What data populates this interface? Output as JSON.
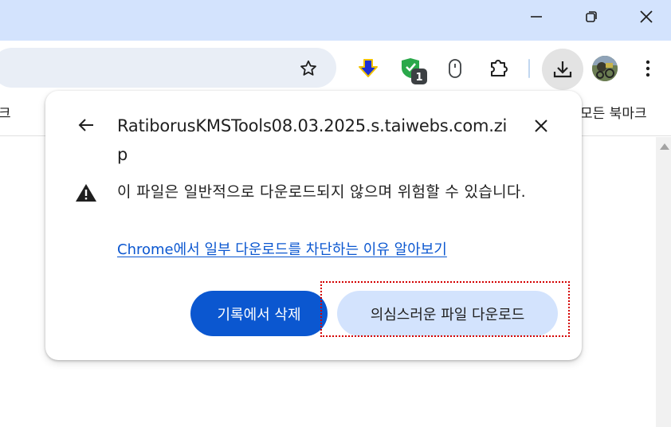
{
  "window": {
    "controls": [
      "minimize-icon",
      "restore-icon",
      "close-icon"
    ]
  },
  "toolbar": {
    "icons": [
      "bookmark-star-icon",
      "download-arrow-extension-icon",
      "shield-extension-icon",
      "mouse-extension-icon",
      "extensions-puzzle-icon",
      "downloads-icon",
      "profile-avatar",
      "more-menu-icon"
    ],
    "extension_badge": "1"
  },
  "bookmarks": {
    "left_fragment": "크",
    "all_bookmarks": "모든 북마크"
  },
  "popup": {
    "filename": "RatiborusKMSTools08.03.2025.s.taiwebs.com.zip",
    "warning": "이 파일은 일반적으로 다운로드되지 않으며 위험할 수 있습니다.",
    "learn_more": "Chrome에서 일부 다운로드를 차단하는 이유 알아보기",
    "delete_button": "기록에서 삭제",
    "download_button": "의심스러운 파일 다운로드"
  },
  "colors": {
    "titlebar": "#d3e3fd",
    "omnibox": "#e9eef6",
    "primary_button": "#0b57d0",
    "secondary_button": "#d3e3fd",
    "link": "#0b57d0",
    "focus_outline": "#d40000"
  }
}
